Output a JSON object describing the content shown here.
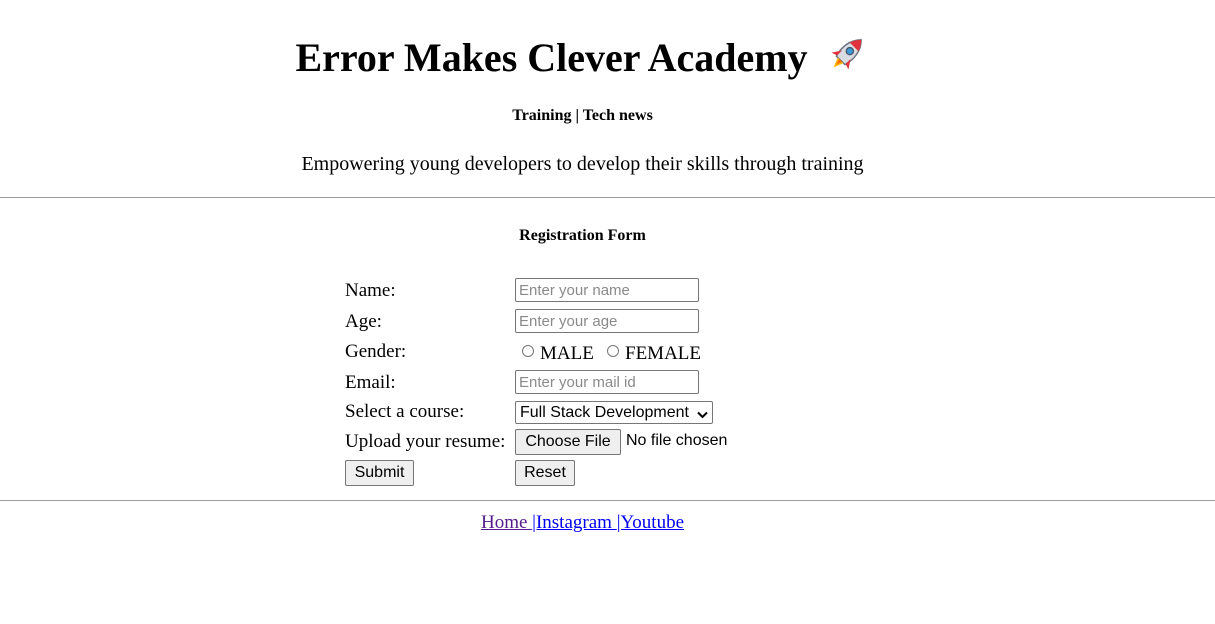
{
  "header": {
    "title": "Error Makes Clever Academy",
    "title_icon": "rocket-icon",
    "subtitle": "Training | Tech news",
    "tagline": "Empowering young developers to develop their skills through training"
  },
  "form": {
    "title": "Registration Form",
    "name": {
      "label": "Name:",
      "placeholder": "Enter your name",
      "value": ""
    },
    "age": {
      "label": "Age:",
      "placeholder": "Enter your age",
      "value": ""
    },
    "gender": {
      "label": "Gender:",
      "options": [
        "MALE",
        "FEMALE"
      ],
      "selected": null
    },
    "email": {
      "label": "Email:",
      "placeholder": "Enter your mail id",
      "value": ""
    },
    "course": {
      "label": "Select a course:",
      "selected": "Full Stack Development"
    },
    "resume": {
      "label": "Upload your resume:",
      "button_label": "Choose File",
      "status": "No file chosen"
    },
    "submit_label": "Submit",
    "reset_label": "Reset"
  },
  "footer": {
    "links": [
      "Home ",
      "|Instagram ",
      "|Youtube"
    ]
  },
  "colors": {
    "visited_link": "#551a8b",
    "link": "#0000ee",
    "rule": "#9a9a9a",
    "button_bg": "#efefef"
  }
}
